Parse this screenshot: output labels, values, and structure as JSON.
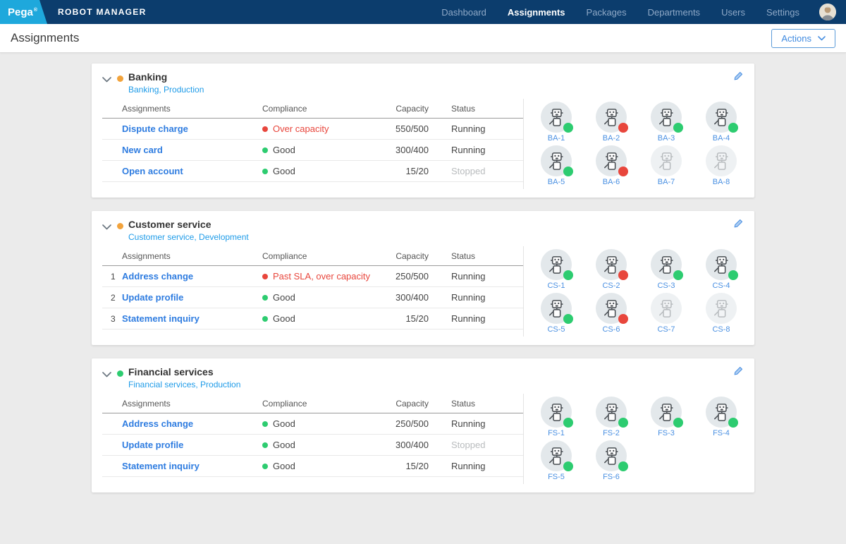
{
  "colors": {
    "navbar_navy": "#0c3d6d",
    "logo_blue": "#1ea8dc",
    "link_blue": "#2e7ce0",
    "subtitle_blue": "#1e9be8",
    "robot_label_blue": "#4a90e2",
    "status_green": "#2dcc70",
    "status_red": "#e8463c",
    "status_orange": "#f2a33c",
    "muted_gray": "#b9bcbe"
  },
  "navbar": {
    "brand": "Pega",
    "brand_mark": "®",
    "app_title": "ROBOT MANAGER",
    "items": [
      {
        "label": "Dashboard",
        "active": false
      },
      {
        "label": "Assignments",
        "active": true
      },
      {
        "label": "Packages",
        "active": false
      },
      {
        "label": "Departments",
        "active": false
      },
      {
        "label": "Users",
        "active": false
      },
      {
        "label": "Settings",
        "active": false
      }
    ]
  },
  "page": {
    "title": "Assignments",
    "actions_button": "Actions"
  },
  "table_columns": [
    "Assignments",
    "Compliance",
    "Capacity",
    "Status"
  ],
  "departments": [
    {
      "name": "Banking",
      "subtitle": "Banking, Production",
      "health_color": "orange",
      "rows": [
        {
          "num": "",
          "name": "Dispute charge",
          "compliance": "Over capacity",
          "compliance_level": "bad",
          "capacity": "550/500",
          "status": "Running",
          "status_muted": false
        },
        {
          "num": "",
          "name": "New card",
          "compliance": "Good",
          "compliance_level": "good",
          "capacity": "300/400",
          "status": "Running",
          "status_muted": false
        },
        {
          "num": "",
          "name": "Open account",
          "compliance": "Good",
          "compliance_level": "good",
          "capacity": "15/20",
          "status": "Stopped",
          "status_muted": true
        }
      ],
      "robots": [
        {
          "label": "BA-1",
          "state": "green"
        },
        {
          "label": "BA-2",
          "state": "red"
        },
        {
          "label": "BA-3",
          "state": "green"
        },
        {
          "label": "BA-4",
          "state": "green"
        },
        {
          "label": "BA-5",
          "state": "green"
        },
        {
          "label": "BA-6",
          "state": "red"
        },
        {
          "label": "BA-7",
          "state": "idle"
        },
        {
          "label": "BA-8",
          "state": "idle"
        }
      ]
    },
    {
      "name": "Customer service",
      "subtitle": "Customer service, Development",
      "health_color": "orange",
      "rows": [
        {
          "num": "1",
          "name": "Address change",
          "compliance": "Past SLA, over capacity",
          "compliance_level": "bad",
          "capacity": "250/500",
          "status": "Running",
          "status_muted": false
        },
        {
          "num": "2",
          "name": "Update profile",
          "compliance": "Good",
          "compliance_level": "good",
          "capacity": "300/400",
          "status": "Running",
          "status_muted": false
        },
        {
          "num": "3",
          "name": "Statement inquiry",
          "compliance": "Good",
          "compliance_level": "good",
          "capacity": "15/20",
          "status": "Running",
          "status_muted": false
        }
      ],
      "robots": [
        {
          "label": "CS-1",
          "state": "green"
        },
        {
          "label": "CS-2",
          "state": "red"
        },
        {
          "label": "CS-3",
          "state": "green"
        },
        {
          "label": "CS-4",
          "state": "green"
        },
        {
          "label": "CS-5",
          "state": "green"
        },
        {
          "label": "CS-6",
          "state": "red"
        },
        {
          "label": "CS-7",
          "state": "idle"
        },
        {
          "label": "CS-8",
          "state": "idle"
        }
      ]
    },
    {
      "name": "Financial services",
      "subtitle": "Financial services, Production",
      "health_color": "green",
      "rows": [
        {
          "num": "",
          "name": "Address change",
          "compliance": "Good",
          "compliance_level": "good",
          "capacity": "250/500",
          "status": "Running",
          "status_muted": false
        },
        {
          "num": "",
          "name": "Update profile",
          "compliance": "Good",
          "compliance_level": "good",
          "capacity": "300/400",
          "status": "Stopped",
          "status_muted": true
        },
        {
          "num": "",
          "name": "Statement inquiry",
          "compliance": "Good",
          "compliance_level": "good",
          "capacity": "15/20",
          "status": "Running",
          "status_muted": false
        }
      ],
      "robots": [
        {
          "label": "FS-1",
          "state": "green"
        },
        {
          "label": "FS-2",
          "state": "green"
        },
        {
          "label": "FS-3",
          "state": "green"
        },
        {
          "label": "FS-4",
          "state": "green"
        },
        {
          "label": "FS-5",
          "state": "green"
        },
        {
          "label": "FS-6",
          "state": "green"
        }
      ]
    }
  ]
}
